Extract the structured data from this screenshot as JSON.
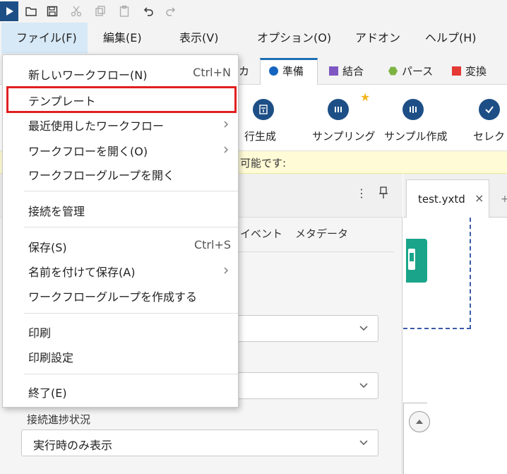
{
  "menubar": {
    "file": "ファイル(F)",
    "edit": "編集(E)",
    "view": "表示(V)",
    "options": "オプション(O)",
    "addons": "アドオン",
    "help": "ヘルプ(H)"
  },
  "ribbon": {
    "tabs": [
      {
        "label": "カ"
      },
      {
        "label": "準備",
        "color": "#1565c0"
      },
      {
        "label": "結合",
        "color": "#7e57c2"
      },
      {
        "label": "パース",
        "color": "#7cb342"
      },
      {
        "label": "変換",
        "color": "#e53935"
      }
    ],
    "tools": [
      {
        "label": "行生成"
      },
      {
        "label": "サンプリング"
      },
      {
        "label": "サンプル作成"
      },
      {
        "label": "セレクト"
      }
    ]
  },
  "infobar": {
    "text": "可能です:"
  },
  "config_panel": {
    "tabs": [
      "イベント",
      "メタデータ"
    ],
    "progress_label": "接続進捗状況",
    "progress_value": "実行時のみ表示"
  },
  "document": {
    "tab": "test.yxtd"
  },
  "file_menu": {
    "items": [
      {
        "label": "新しいワークフロー(N)",
        "shortcut": "Ctrl+N"
      },
      {
        "label": "テンプレート"
      },
      {
        "label": "最近使用したワークフロー"
      },
      {
        "label": "ワークフローを開く(O)"
      },
      {
        "label": "ワークフローグループを開く"
      },
      {
        "label": "接続を管理"
      },
      {
        "label": "保存(S)",
        "shortcut": "Ctrl+S"
      },
      {
        "label": "名前を付けて保存(A)"
      },
      {
        "label": "ワークフローグループを作成する"
      },
      {
        "label": "印刷"
      },
      {
        "label": "印刷設定"
      },
      {
        "label": "終了(E)"
      }
    ]
  },
  "colors": {
    "accent": "#1f6fb2",
    "highlight": "#e02020",
    "tool_teal": "#1aa58a"
  }
}
